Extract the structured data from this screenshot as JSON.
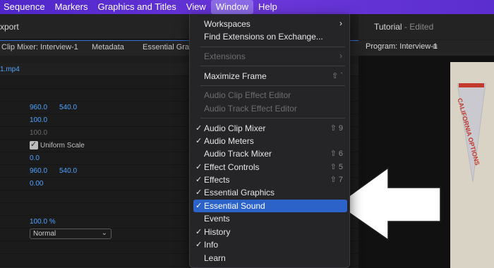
{
  "menubar": {
    "items": [
      "Sequence",
      "Markers",
      "Graphics and Titles",
      "View",
      "Window",
      "Help"
    ],
    "active": "Window"
  },
  "left_panel": {
    "header_title": "xport",
    "tabs": [
      "Clip Mixer: Interview-1",
      "Metadata",
      "Essential Graphi"
    ],
    "clip_name": "1.mp4",
    "position": [
      "960.0",
      "540.0"
    ],
    "scale": "100.0",
    "scale_width": "100.0",
    "uniform_scale_label": "Uniform Scale",
    "rotation": "0.0",
    "anchor_point": [
      "960.0",
      "540.0"
    ],
    "anti_flicker": "0.00",
    "opacity": "100.0 %",
    "blend_mode": "Normal"
  },
  "right_panel": {
    "title": "Tutorial",
    "title_suffix": " - Edited",
    "program_tab": "Program: Interview-1",
    "menu_icon": "hamburger-icon",
    "pennant_text": "CALIFORNIA OPTIONS"
  },
  "window_menu": {
    "items": [
      {
        "label": "Workspaces",
        "submenu": true,
        "check": "",
        "shortcut": "",
        "disabled": false
      },
      {
        "label": "Find Extensions on Exchange...",
        "submenu": false,
        "check": "",
        "shortcut": "",
        "disabled": false
      },
      {
        "label": "Extensions",
        "submenu": true,
        "check": "",
        "shortcut": "",
        "disabled": true
      },
      {
        "label": "Maximize Frame",
        "submenu": false,
        "check": "",
        "shortcut": "⇧ `",
        "disabled": false
      },
      {
        "label": "Audio Clip Effect Editor",
        "submenu": false,
        "check": "",
        "shortcut": "",
        "disabled": true
      },
      {
        "label": "Audio Track Effect Editor",
        "submenu": false,
        "check": "",
        "shortcut": "",
        "disabled": true
      },
      {
        "label": "Audio Clip Mixer",
        "submenu": false,
        "check": "✓",
        "shortcut": "⇧ 9",
        "disabled": false
      },
      {
        "label": "Audio Meters",
        "submenu": false,
        "check": "✓",
        "shortcut": "",
        "disabled": false
      },
      {
        "label": "Audio Track Mixer",
        "submenu": false,
        "check": "",
        "shortcut": "⇧ 6",
        "disabled": false
      },
      {
        "label": "Effect Controls",
        "submenu": false,
        "check": "✓",
        "shortcut": "⇧ 5",
        "disabled": false
      },
      {
        "label": "Effects",
        "submenu": false,
        "check": "✓",
        "shortcut": "⇧ 7",
        "disabled": false
      },
      {
        "label": "Essential Graphics",
        "submenu": false,
        "check": "✓",
        "shortcut": "",
        "disabled": false
      },
      {
        "label": "Essential Sound",
        "submenu": false,
        "check": "✓",
        "shortcut": "",
        "disabled": false,
        "highlighted": true
      },
      {
        "label": "Events",
        "submenu": false,
        "check": "",
        "shortcut": "",
        "disabled": false
      },
      {
        "label": "History",
        "submenu": false,
        "check": "✓",
        "shortcut": "",
        "disabled": false
      },
      {
        "label": "Info",
        "submenu": false,
        "check": "✓",
        "shortcut": "",
        "disabled": false
      },
      {
        "label": "Learn",
        "submenu": false,
        "check": "",
        "shortcut": "",
        "disabled": false
      }
    ]
  },
  "colors": {
    "menubar": "#5a2fd1",
    "highlight": "#2b63c9",
    "value_blue": "#4fa3ff"
  }
}
